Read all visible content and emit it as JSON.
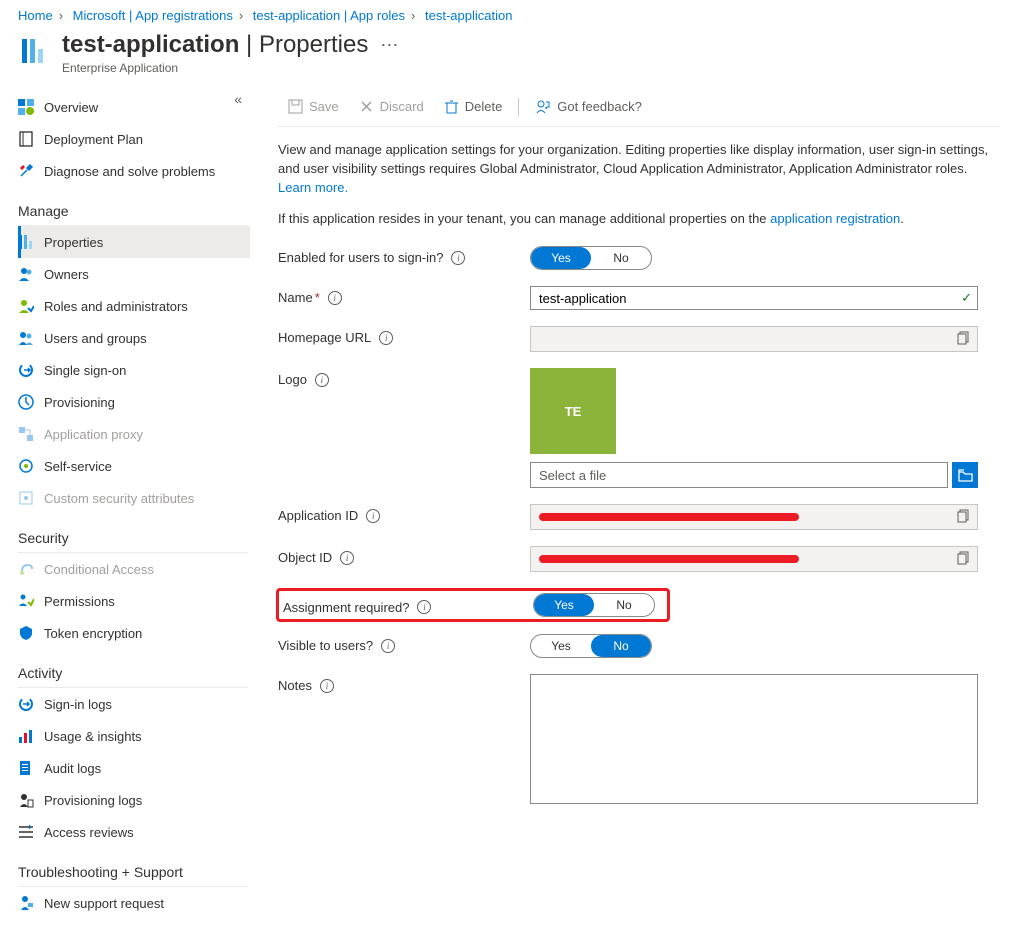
{
  "breadcrumb": {
    "items": [
      "Home",
      "Microsoft | App registrations",
      "test-application | App roles",
      "test-application"
    ]
  },
  "header": {
    "title_app": "test-application",
    "title_page": "Properties",
    "subtitle": "Enterprise Application"
  },
  "toolbar": {
    "save": "Save",
    "discard": "Discard",
    "delete": "Delete",
    "feedback": "Got feedback?"
  },
  "intro": {
    "line1a": "View and manage application settings for your organization. Editing properties like display information, user sign-in settings, and user visibility settings requires Global Administrator, Cloud Application Administrator, Application Administrator roles. ",
    "learn": "Learn more.",
    "line2a": "If this application resides in your tenant, you can manage additional properties on the ",
    "link2": "application registration",
    "line2b": "."
  },
  "fields": {
    "enabled": {
      "label": "Enabled for users to sign-in?",
      "yes": "Yes",
      "no": "No",
      "value": "Yes"
    },
    "name": {
      "label": "Name",
      "value": "test-application"
    },
    "homepage": {
      "label": "Homepage URL",
      "value": ""
    },
    "logo": {
      "label": "Logo",
      "placeholder": "Select a file",
      "initials": "TE"
    },
    "appid": {
      "label": "Application ID"
    },
    "objid": {
      "label": "Object ID"
    },
    "assign": {
      "label": "Assignment required?",
      "yes": "Yes",
      "no": "No",
      "value": "Yes"
    },
    "visible": {
      "label": "Visible to users?",
      "yes": "Yes",
      "no": "No",
      "value": "No"
    },
    "notes": {
      "label": "Notes"
    }
  },
  "nav": {
    "top": {
      "overview": "Overview",
      "deployment": "Deployment Plan",
      "diagnose": "Diagnose and solve problems"
    },
    "manage_title": "Manage",
    "manage": {
      "properties": "Properties",
      "owners": "Owners",
      "roles": "Roles and administrators",
      "users": "Users and groups",
      "sso": "Single sign-on",
      "prov": "Provisioning",
      "proxy": "Application proxy",
      "self": "Self-service",
      "csa": "Custom security attributes"
    },
    "security_title": "Security",
    "security": {
      "ca": "Conditional Access",
      "perm": "Permissions",
      "token": "Token encryption"
    },
    "activity_title": "Activity",
    "activity": {
      "signin": "Sign-in logs",
      "usage": "Usage & insights",
      "audit": "Audit logs",
      "provlogs": "Provisioning logs",
      "access": "Access reviews"
    },
    "trouble_title": "Troubleshooting + Support",
    "trouble": {
      "support": "New support request"
    }
  }
}
